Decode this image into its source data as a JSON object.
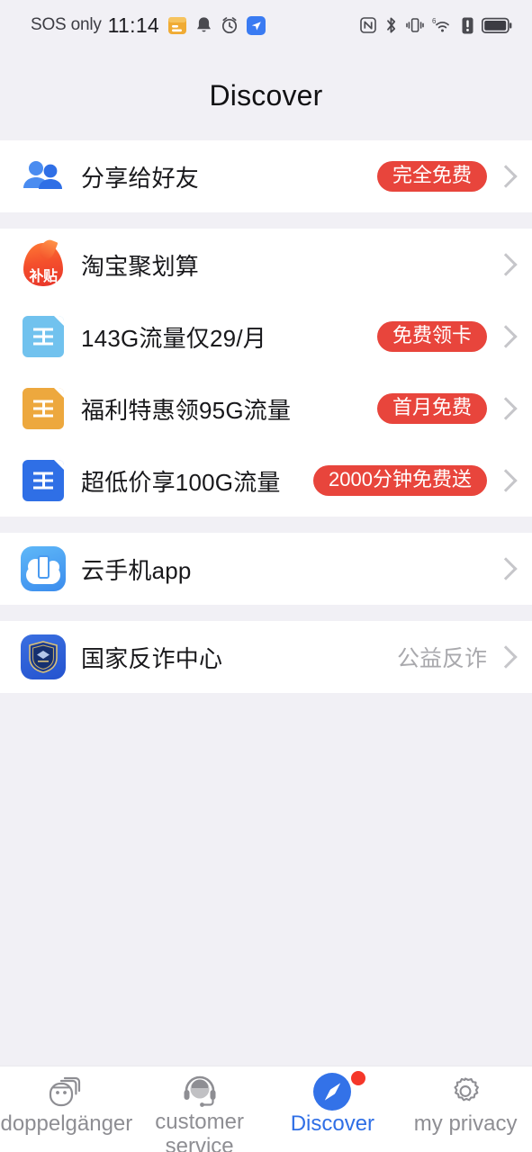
{
  "status_bar": {
    "carrier": "SOS only",
    "time": "11:14",
    "left_icons": [
      "calendar-icon",
      "bell-icon",
      "alarm-clock-icon",
      "app-blue-icon"
    ],
    "right_icons": [
      "nfc-icon",
      "bluetooth-icon",
      "vibrate-icon",
      "wifi-6-icon",
      "alert-icon",
      "battery-icon"
    ],
    "wifi_generation": "6"
  },
  "header": {
    "title": "Discover"
  },
  "sections": [
    {
      "rows": [
        {
          "icon": "people-share-icon",
          "label": "分享给好友",
          "badge": "完全免费",
          "sub": "",
          "chevron": true
        }
      ]
    },
    {
      "rows": [
        {
          "icon": "flame-subsidy-icon",
          "icon_text": "补贴",
          "label": "淘宝聚划算",
          "badge": "",
          "sub": "",
          "chevron": true
        },
        {
          "icon": "sim-card-icon",
          "icon_color": "#71c2ee",
          "label": "143G流量仅29/月",
          "badge": "免费领卡",
          "sub": "",
          "chevron": true
        },
        {
          "icon": "sim-card-icon",
          "icon_color": "#eda83e",
          "label": "福利特惠领95G流量",
          "badge": "首月免费",
          "sub": "",
          "chevron": true
        },
        {
          "icon": "sim-card-icon",
          "icon_color": "#2f6fe6",
          "label": "超低价享100G流量",
          "badge": "2000分钟免费送",
          "sub": "",
          "chevron": true
        }
      ]
    },
    {
      "rows": [
        {
          "icon": "cloud-phone-app-icon",
          "label": "云手机app",
          "badge": "",
          "sub": "",
          "chevron": true
        }
      ]
    },
    {
      "rows": [
        {
          "icon": "police-shield-icon",
          "label": "国家反诈中心",
          "badge": "",
          "sub": "公益反诈",
          "chevron": true
        }
      ]
    }
  ],
  "tabbar": {
    "items": [
      {
        "icon": "doppelganger-icon",
        "label": "doppelgänger",
        "active": false,
        "badge": false
      },
      {
        "icon": "headset-support-icon",
        "label": "customer service",
        "active": false,
        "badge": false
      },
      {
        "icon": "compass-icon",
        "label": "Discover",
        "active": true,
        "badge": true
      },
      {
        "icon": "gear-icon",
        "label": "my privacy",
        "active": false,
        "badge": false
      }
    ]
  },
  "colors": {
    "badge_red": "#e8453c",
    "accent_blue": "#2f6fe6",
    "page_bg": "#f1f0f5",
    "card_bg": "#ffffff",
    "muted_text": "#a9a9ad"
  }
}
